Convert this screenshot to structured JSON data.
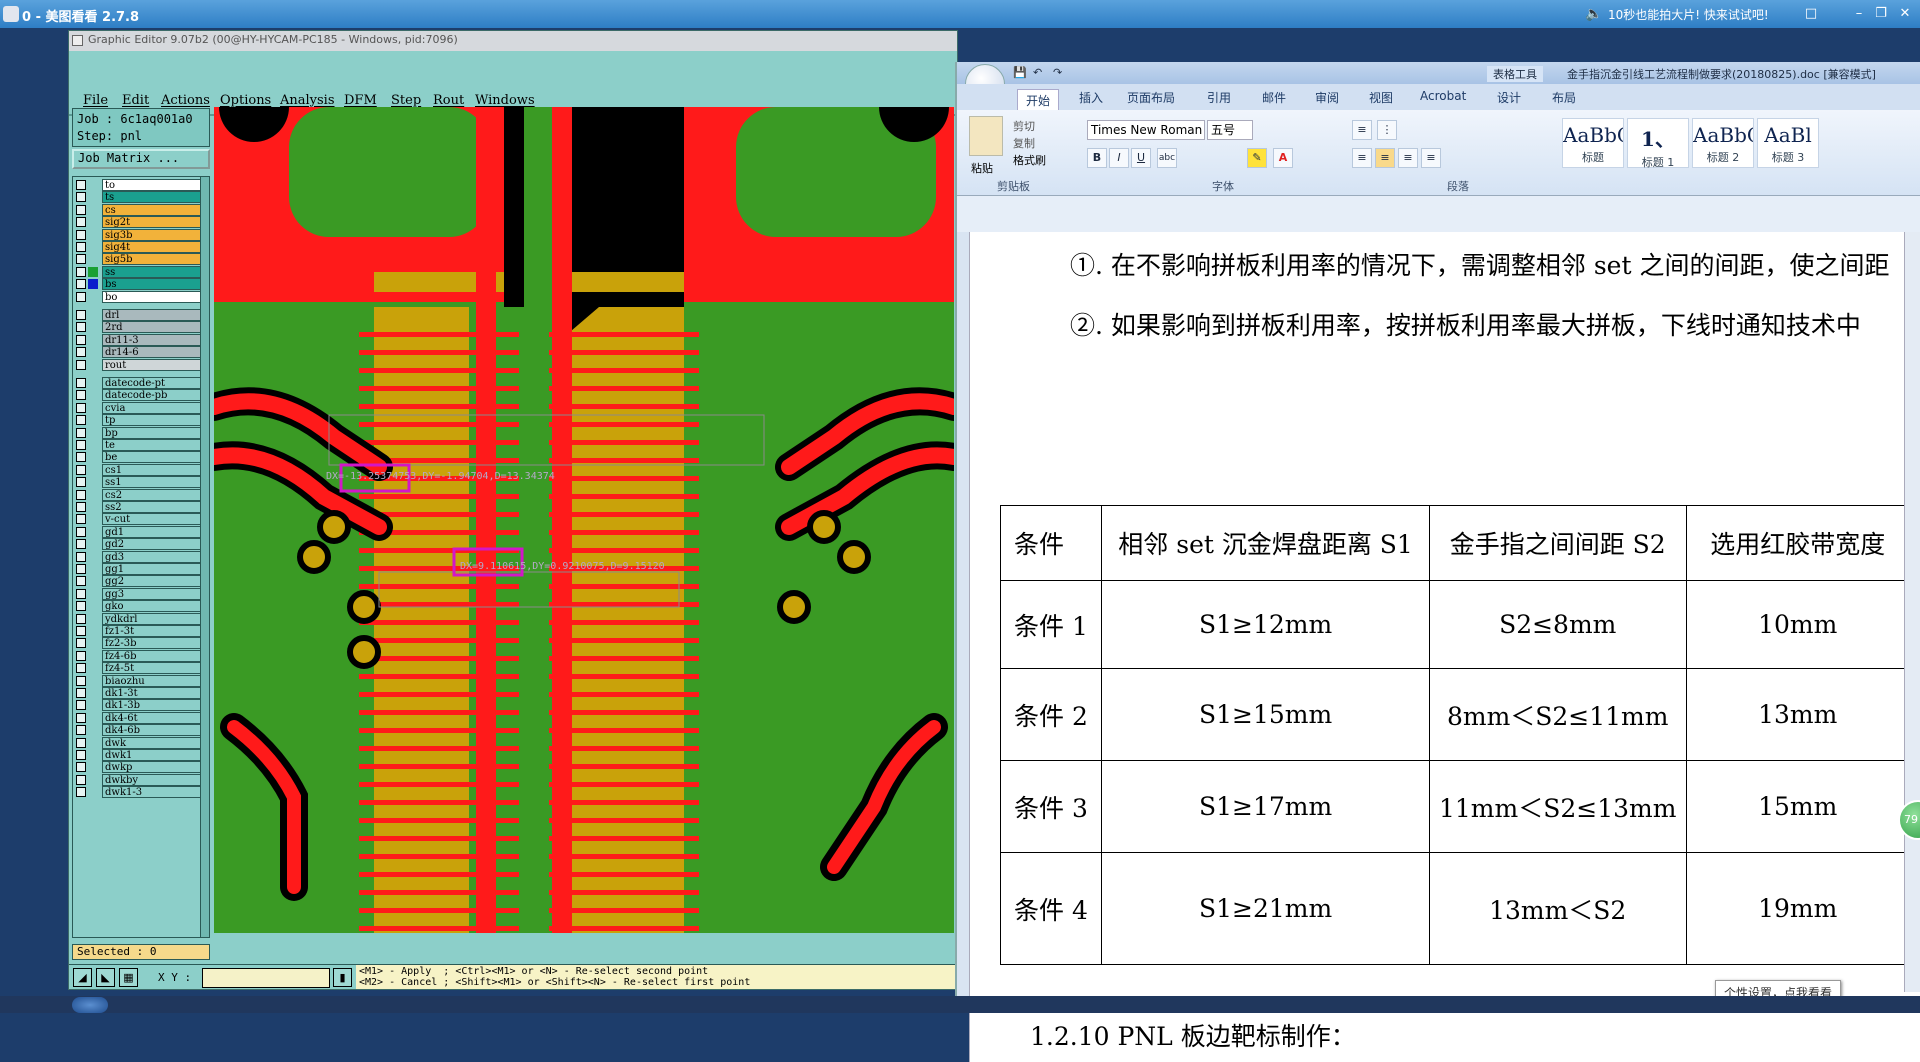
{
  "viewer": {
    "title": "0 - 美图看看 2.7.8",
    "promo": "10秒也能拍大片! 快来试试吧!",
    "buttons": [
      "□",
      "–",
      "❐",
      "✕"
    ]
  },
  "graphic_editor": {
    "title": "Graphic Editor 9.07b2 (00@HY-HYCAM-PC185 - Windows, pid:7096)",
    "menu": [
      "File",
      "Edit",
      "Actions",
      "Options",
      "Analysis",
      "DFM",
      "Step",
      "Rout",
      "Windows"
    ],
    "job": "Job  : 6c1aq001a0",
    "step": "Step: pnl",
    "job_matrix": "Job Matrix ...",
    "layers": [
      {
        "name": "to",
        "color": "#ffffff",
        "sel": false
      },
      {
        "name": "ts",
        "color": "#1aa08f",
        "sel": false
      },
      {
        "name": "cs",
        "color": "#f2b23a",
        "sel": false
      },
      {
        "name": "sig2t",
        "color": "#f2b23a",
        "sel": false
      },
      {
        "name": "sig3b",
        "color": "#f2b23a",
        "sel": false
      },
      {
        "name": "sig4t",
        "color": "#f2b23a",
        "sel": false
      },
      {
        "name": "sig5b",
        "color": "#f2b23a",
        "sel": false
      },
      {
        "name": "ss",
        "color": "#1aa08f",
        "sel": true
      },
      {
        "name": "bs",
        "color": "#1aa08f",
        "sel": true
      },
      {
        "name": "bo",
        "color": "#ffffff",
        "sel": false
      },
      {
        "name": "drl",
        "color": "#a9b9bd",
        "sel": false
      },
      {
        "name": "2rd",
        "color": "#a9b9bd",
        "sel": false
      },
      {
        "name": "dr11-3",
        "color": "#a9b9bd",
        "sel": false
      },
      {
        "name": "dr14-6",
        "color": "#a9b9bd",
        "sel": false
      },
      {
        "name": "rout",
        "color": "#cfd6d8",
        "sel": false
      },
      {
        "name": "datecode-pt",
        "color": "#8ccfc9",
        "sel": false
      },
      {
        "name": "datecode-pb",
        "color": "#8ccfc9",
        "sel": false
      },
      {
        "name": "cvia",
        "color": "#8ccfc9",
        "sel": false
      },
      {
        "name": "tp",
        "color": "#8ccfc9",
        "sel": false
      },
      {
        "name": "bp",
        "color": "#8ccfc9",
        "sel": false
      },
      {
        "name": "te",
        "color": "#8ccfc9",
        "sel": false
      },
      {
        "name": "be",
        "color": "#8ccfc9",
        "sel": false
      },
      {
        "name": "cs1",
        "color": "#8ccfc9",
        "sel": false
      },
      {
        "name": "ss1",
        "color": "#8ccfc9",
        "sel": false
      },
      {
        "name": "cs2",
        "color": "#8ccfc9",
        "sel": false
      },
      {
        "name": "ss2",
        "color": "#8ccfc9",
        "sel": false
      },
      {
        "name": "v-cut",
        "color": "#8ccfc9",
        "sel": false
      },
      {
        "name": "gd1",
        "color": "#8ccfc9",
        "sel": false
      },
      {
        "name": "gd2",
        "color": "#8ccfc9",
        "sel": false
      },
      {
        "name": "gd3",
        "color": "#8ccfc9",
        "sel": false
      },
      {
        "name": "gg1",
        "color": "#8ccfc9",
        "sel": false
      },
      {
        "name": "gg2",
        "color": "#8ccfc9",
        "sel": false
      },
      {
        "name": "gg3",
        "color": "#8ccfc9",
        "sel": false
      },
      {
        "name": "gko",
        "color": "#8ccfc9",
        "sel": false
      },
      {
        "name": "ydkdrl",
        "color": "#8ccfc9",
        "sel": false
      },
      {
        "name": "fz1-3t",
        "color": "#8ccfc9",
        "sel": false
      },
      {
        "name": "fz2-3b",
        "color": "#8ccfc9",
        "sel": false
      },
      {
        "name": "fz4-6b",
        "color": "#8ccfc9",
        "sel": false
      },
      {
        "name": "fz4-5t",
        "color": "#8ccfc9",
        "sel": false
      },
      {
        "name": "biaozhu",
        "color": "#8ccfc9",
        "sel": false
      },
      {
        "name": "dk1-3t",
        "color": "#8ccfc9",
        "sel": false
      },
      {
        "name": "dk1-3b",
        "color": "#8ccfc9",
        "sel": false
      },
      {
        "name": "dk4-6t",
        "color": "#8ccfc9",
        "sel": false
      },
      {
        "name": "dk4-6b",
        "color": "#8ccfc9",
        "sel": false
      },
      {
        "name": "dwk",
        "color": "#8ccfc9",
        "sel": false
      },
      {
        "name": "dwk1",
        "color": "#8ccfc9",
        "sel": false
      },
      {
        "name": "dwkp",
        "color": "#8ccfc9",
        "sel": false
      },
      {
        "name": "dwkby",
        "color": "#8ccfc9",
        "sel": false
      },
      {
        "name": "dwk1-3",
        "color": "#8ccfc9",
        "sel": false
      }
    ],
    "selected": "Selected : 0",
    "xy_label": "X Y :",
    "xy_value": "",
    "help_line1": "<M1> - Apply  ; <Ctrl><M1> or <N> - Re-select second point",
    "help_line2": "<M2> - Cancel ; <Shift><M1> or <Shift><N> - Re-select first point",
    "measure1": "DX=-13.25374753,DY=-1.94704,D=13.34374",
    "measure2": "DX=9.110615,DY=0.9210075,D=9.15120",
    "colors": {
      "copper": "#ff1a1a",
      "gold": "#c9a20a",
      "mask": "#3a9a24",
      "base": "#000000",
      "highlight": "#d316c8"
    }
  },
  "word": {
    "tools_title": "表格工具",
    "doc_title": "金手指沉金引线工艺流程制做要求(20180825).doc [兼容模式]",
    "tabs": [
      "开始",
      "插入",
      "页面布局",
      "引用",
      "邮件",
      "审阅",
      "视图",
      "Acrobat",
      "设计",
      "布局"
    ],
    "font_name": "Times New Roman",
    "font_size": "五号",
    "clipboard": {
      "paste": "粘贴",
      "cut": "剪切",
      "copy": "复制",
      "format": "格式刷"
    },
    "groups": [
      "剪贴板",
      "字体",
      "段落"
    ],
    "styles": [
      {
        "preview": "AaBbC",
        "name": "标题"
      },
      {
        "preview": "1、",
        "name": "标题 1"
      },
      {
        "preview": "AaBbC",
        "name": "标题 2"
      },
      {
        "preview": "AaBl",
        "name": "标题 3"
      }
    ],
    "para1": "①. 在不影响拼板利用率的情况下，需调整相邻 set 之间的间距，使之间距",
    "para2": "②. 如果影响到拼板利用率，按拼板利用率最大拼板，下线时通知技术中",
    "table": {
      "headers": [
        "条件",
        "相邻 set 沉金焊盘距离 S1",
        "金手指之间间距 S2",
        "选用红胶带宽度"
      ],
      "rows": [
        [
          "条件 1",
          "S1≥12mm",
          "S2≤8mm",
          "10mm"
        ],
        [
          "条件 2",
          "S1≥15mm",
          "8mm＜S2≤11mm",
          "13mm"
        ],
        [
          "条件 3",
          "S1≥17mm",
          "11mm＜S2≤13mm",
          "15mm"
        ],
        [
          "条件 4",
          "S1≥21mm",
          "13mm＜S2",
          "19mm"
        ]
      ]
    },
    "heading": "1.2.10 PNL 板边靶标制作：",
    "tooltip": "个性设置，点我看看",
    "ball": "79"
  }
}
